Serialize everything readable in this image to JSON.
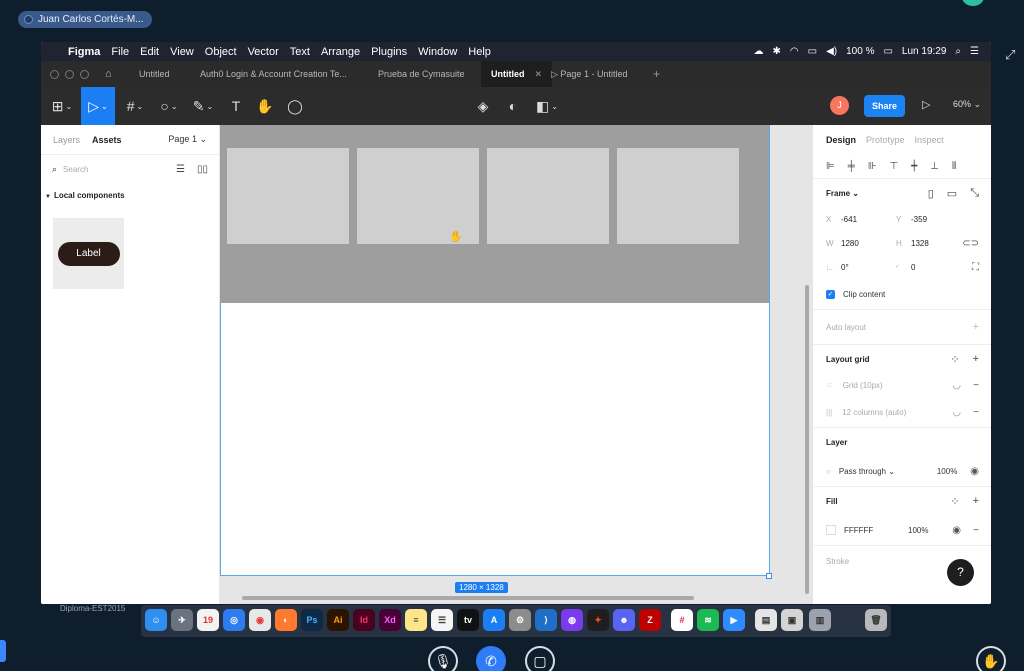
{
  "call": {
    "participant": "Juan Carlos Cortés-M..."
  },
  "menubar": {
    "app": "Figma",
    "items": [
      "File",
      "Edit",
      "View",
      "Object",
      "Vector",
      "Text",
      "Arrange",
      "Plugins",
      "Window",
      "Help"
    ],
    "battery": "100 %",
    "clock": "Lun 19:29"
  },
  "tabs": {
    "items": [
      {
        "label": "Untitled"
      },
      {
        "label": "Auth0 Login & Account Creation Te..."
      },
      {
        "label": "Prueba de Cymasuite"
      },
      {
        "label": "Untitled"
      },
      {
        "label": "▷  Page 1 - Untitled"
      }
    ],
    "close": "✕",
    "add": "+"
  },
  "toolbar": {
    "avatar_initial": "J",
    "share_label": "Share",
    "zoom": "60%"
  },
  "left_panel": {
    "tab_layers": "Layers",
    "tab_assets": "Assets",
    "page": "Page 1",
    "search_placeholder": "Search",
    "section": "Local components",
    "component_label": "Label"
  },
  "canvas": {
    "frame_size": "1280 × 1328"
  },
  "right_panel": {
    "tab_design": "Design",
    "tab_prototype": "Prototype",
    "tab_inspect": "Inspect",
    "frame": {
      "title": "Frame",
      "x_label": "X",
      "x": "-641",
      "y_label": "Y",
      "y": "-359",
      "w_label": "W",
      "w": "1280",
      "h_label": "H",
      "h": "1328",
      "rotation": "0°",
      "radius": "0",
      "clip_content": "Clip content"
    },
    "auto_layout": "Auto layout",
    "layout_grid": {
      "title": "Layout grid",
      "grid": "Grid (10px)",
      "columns": "12 columns (auto)"
    },
    "layer": {
      "title": "Layer",
      "blend": "Pass through",
      "opacity": "100%"
    },
    "fill": {
      "title": "Fill",
      "color": "FFFFFF",
      "opacity": "100%"
    },
    "stroke": "Stroke",
    "help": "?"
  },
  "dock": {
    "label": "Diploma-EST2015",
    "calendar_day": "19"
  }
}
